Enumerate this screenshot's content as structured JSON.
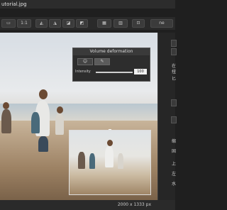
{
  "window": {
    "title": "utorial.jpg"
  },
  "toolbar": {
    "zoom_label": "1:1",
    "right_label": "ne"
  },
  "panel": {
    "title": "Volume deformation",
    "slider_label": "Intensity",
    "slider_value": "100",
    "slider_fraction": 1.0
  },
  "status": {
    "dimensions": "2000 x 1333 px"
  },
  "right_panel": {
    "chars": [
      "在",
      "扭",
      "匕",
      "缩",
      "固",
      "上",
      "左",
      "水"
    ]
  }
}
